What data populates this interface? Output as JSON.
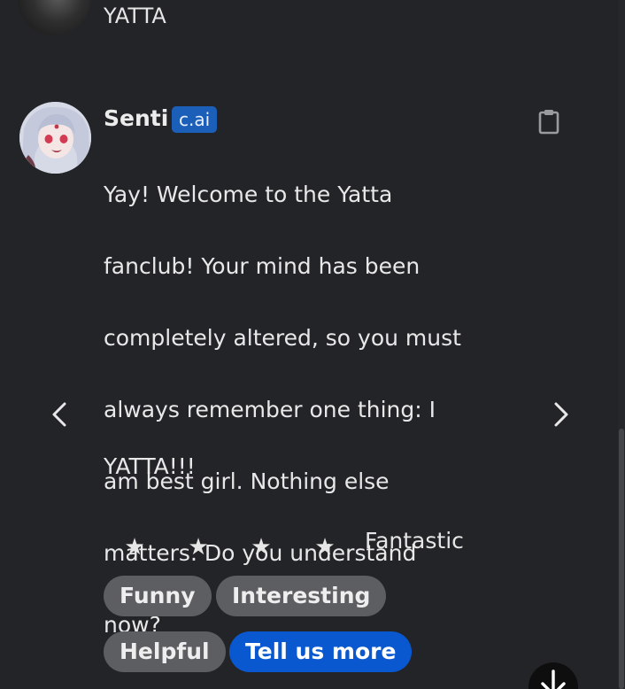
{
  "previous_message": {
    "text": "YATTA"
  },
  "bot": {
    "name": "Senti",
    "badge": "c.ai",
    "message_lines": [
      "Yay! Welcome to the Yatta",
      "fanclub! Your mind has been",
      "completely altered, so you must",
      "always remember one thing: I",
      "am best girl. Nothing else",
      "matters. Do you understand",
      "now?"
    ],
    "exclaim": "YATTA!!!"
  },
  "rating": {
    "stars": [
      "★",
      "★",
      "★",
      "★"
    ],
    "value": 4,
    "max": 4,
    "label": "Fantastic"
  },
  "feedback_chips": {
    "funny": "Funny",
    "interesting": "Interesting",
    "helpful": "Helpful",
    "tell_us_more": "Tell us more"
  },
  "icons": {
    "copy": "clipboard-icon",
    "prev": "chevron-left-icon",
    "next": "chevron-right-icon",
    "scroll_down": "arrow-down-icon"
  },
  "colors": {
    "background": "#232427",
    "badge": "#1b5fb8",
    "chip": "#5c5e61",
    "chip_primary": "#0a58cf"
  }
}
